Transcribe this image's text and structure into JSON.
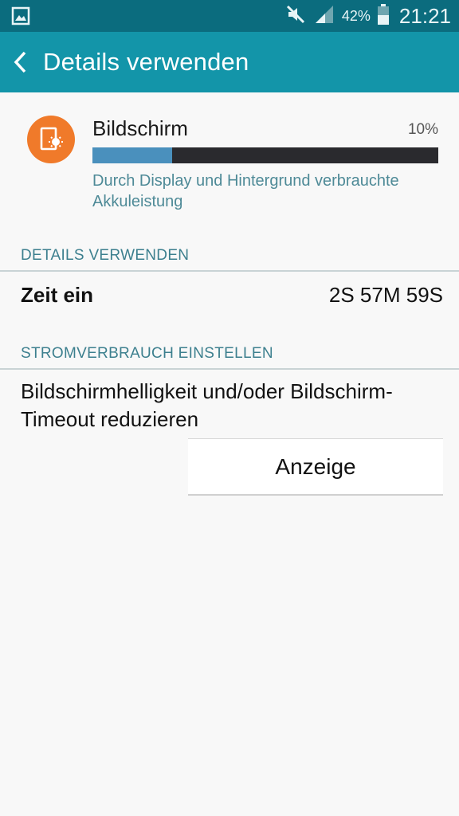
{
  "status_bar": {
    "battery_percent": "42%",
    "time": "21:21",
    "icons": [
      "gallery-icon",
      "mute-icon",
      "signal-icon",
      "battery-icon"
    ]
  },
  "app_bar": {
    "title": "Details verwenden",
    "back_icon": "chevron-left-icon"
  },
  "usage_item": {
    "name": "Bildschirm",
    "percent_label": "10%",
    "percent_value": 0.23,
    "description": "Durch Display und Hintergrund verbrauchte Akkuleistung",
    "icon": "screen-brightness-icon",
    "icon_color": "#f07a2a",
    "bar_fill_color": "#4a90bd",
    "bar_track_color": "#2a2a2e"
  },
  "details_section": {
    "header": "DETAILS VERWENDEN",
    "rows": [
      {
        "label": "Zeit ein",
        "value": "2S 57M 59S"
      }
    ]
  },
  "power_section": {
    "header": "STROMVERBRAUCH EINSTELLEN",
    "tip": "Bildschirmhelligkeit und/oder Bildschirm-Timeout reduzieren",
    "button_label": "Anzeige"
  },
  "colors": {
    "status_bar": "#0b6c7e",
    "app_bar": "#1395a9",
    "section_header_text": "#3c7f8e"
  }
}
